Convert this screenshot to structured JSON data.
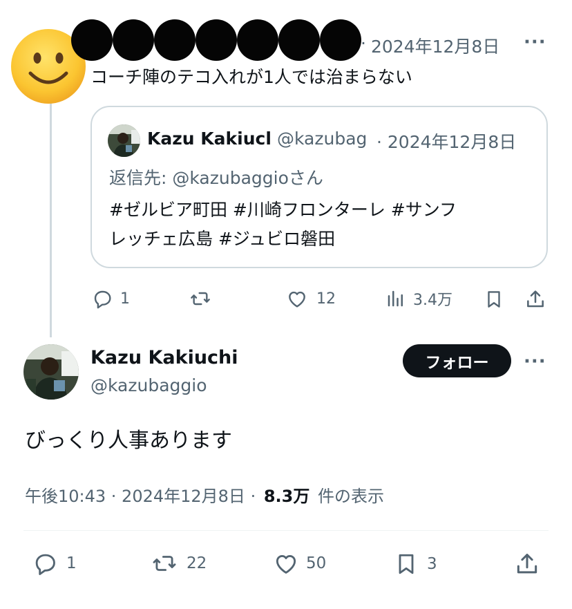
{
  "parent_tweet": {
    "avatar_icon": "slightly-smiling-face-icon",
    "time": "2024年12月8日",
    "text": "コーチ陣のテコ入れが1人では治まらない",
    "reply_count": "1",
    "like_count": "12",
    "view_count": "3.4万"
  },
  "quoted_tweet": {
    "name": "Kazu Kakiucl",
    "handle": "@kazubag",
    "time": "· 2024年12月8日",
    "reply_to": "返信先: @kazubaggioさん",
    "text_line1": "#ゼルビア町田 #川崎フロンターレ #サンフ",
    "text_line2": "レッチェ広島 #ジュビロ磐田"
  },
  "main_tweet": {
    "name": "Kazu Kakiuchi",
    "handle": "@kazubaggio",
    "follow_label": "フォロー",
    "text": "びっくり人事あります",
    "meta_time": "午後10:43 · 2024年12月8日 ·",
    "meta_views": "8.3万",
    "meta_views_suffix": "件の表示",
    "reply_count": "1",
    "retweet_count": "22",
    "like_count": "50",
    "bookmark_count": "3"
  },
  "colors": {
    "text": "#0f1419",
    "secondary": "#536471",
    "border": "#cfd9de",
    "follow_bg": "#0f1419"
  }
}
